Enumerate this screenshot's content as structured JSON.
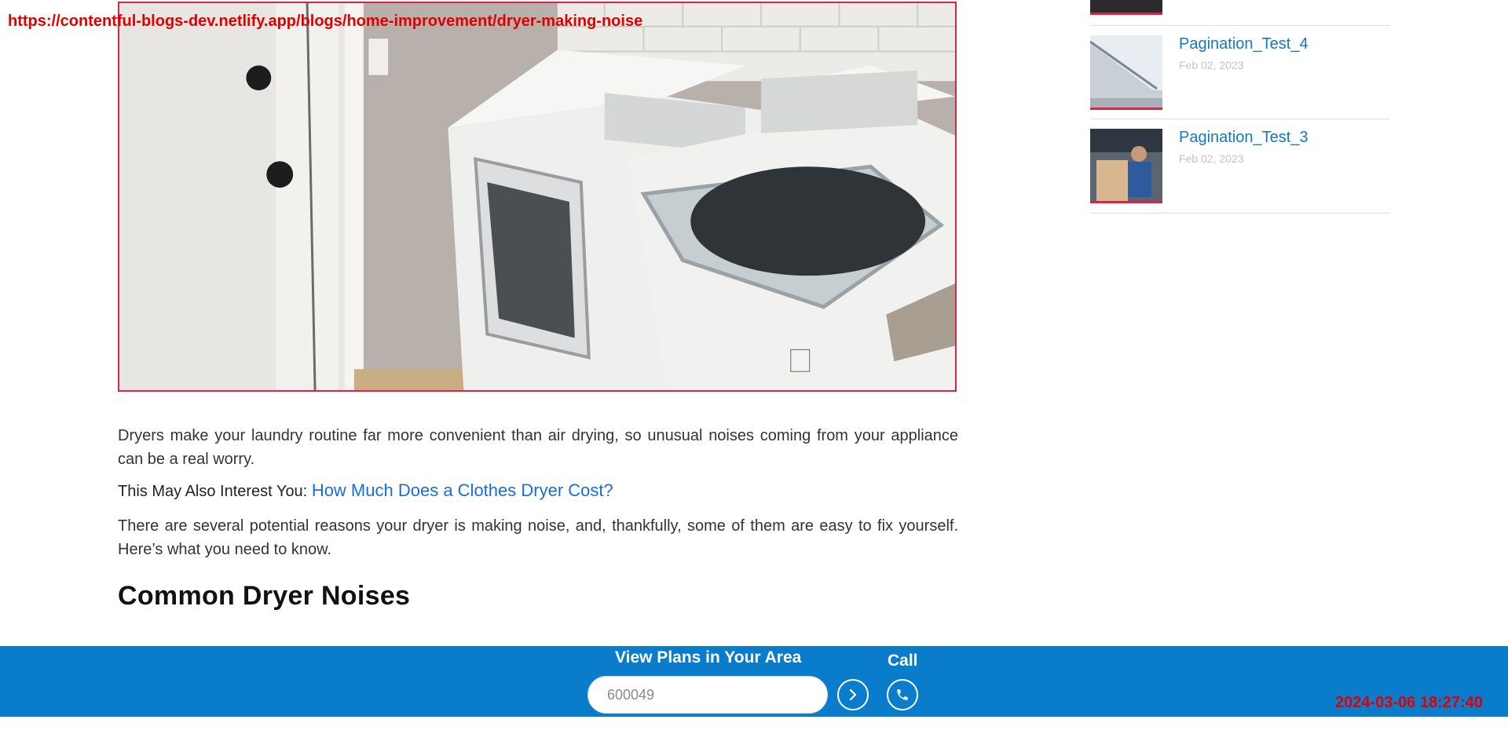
{
  "overlay": {
    "url": "https://contentful-blogs-dev.netlify.app/blogs/home-improvement/dryer-making-noise",
    "timestamp": "2024-03-06 18:27:40"
  },
  "article": {
    "paragraph1": "Dryers make your laundry routine far more convenient than air drying, so unusual noises coming from your appliance can be a real worry.",
    "also_interest_label": "This May Also Interest You:",
    "also_interest_link": "How Much Does a Clothes Dryer Cost?",
    "paragraph2": "There are several potential reasons your dryer is making noise, and, thankfully, some of them are easy to fix yourself. Here’s what you need to know.",
    "heading": "Common Dryer Noises"
  },
  "sidebar": {
    "items": [
      {
        "title": "Pagination_Test_4",
        "date": "Feb 02, 2023",
        "thumb_icon": "house-roof-photo"
      },
      {
        "title": "Pagination_Test_3",
        "date": "Feb 02, 2023",
        "thumb_icon": "technician-photo"
      }
    ]
  },
  "sticky_bar": {
    "view_plans_label": "View Plans in Your Area",
    "zip_value": "600049",
    "call_label": "Call",
    "go_icon": "chevron-right-icon",
    "call_icon": "phone-icon",
    "bg_color": "#0a7ccc"
  }
}
